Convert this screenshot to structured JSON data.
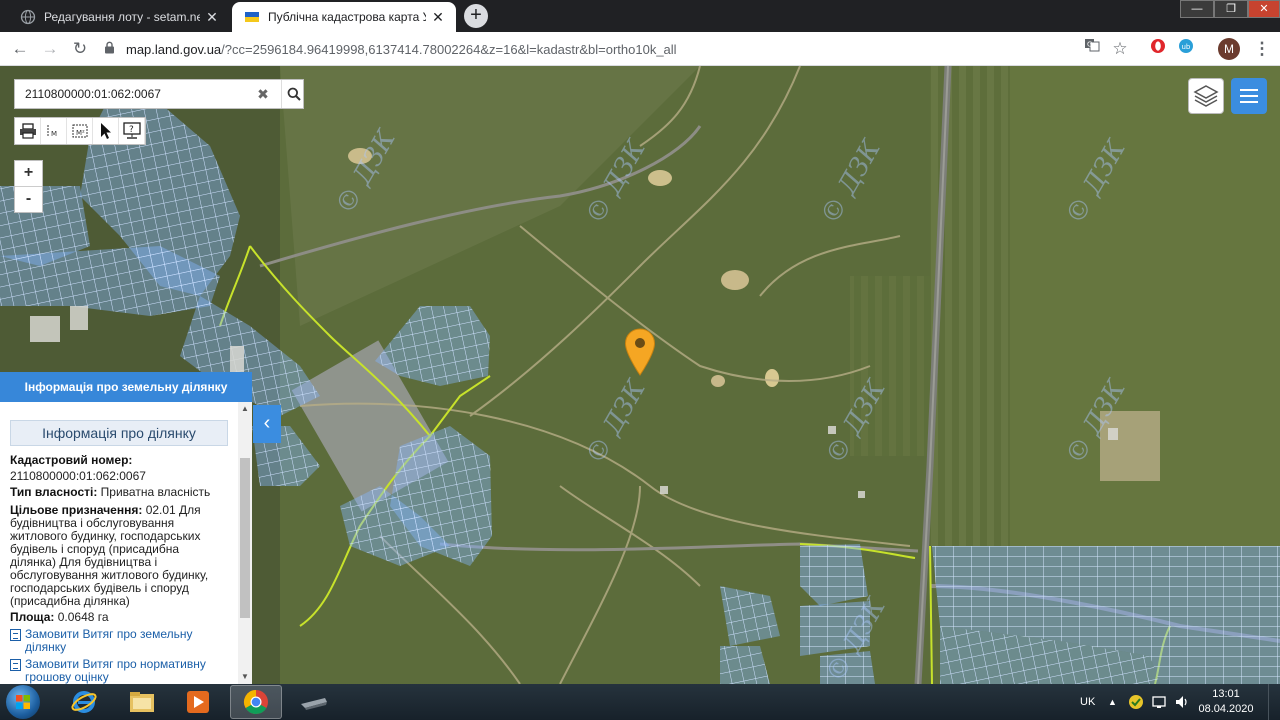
{
  "browser": {
    "tabs": [
      {
        "title": "Редагування лоту - setam.net.ua",
        "favicon": "globe-icon",
        "active": false
      },
      {
        "title": "Публічна кадастрова карта Укр",
        "favicon": "ukraine-flag-icon",
        "active": true
      }
    ],
    "new_tab_label": "+",
    "url_host": "map.land.gov.ua",
    "url_path": "/?cc=2596184.96419998,6137414.78002264&z=16&l=kadastr&bl=ortho10k_all",
    "profile_initial": "M",
    "window_controls": {
      "minimize": "—",
      "maximize": "❐",
      "close": "✕"
    }
  },
  "map": {
    "search": {
      "value": "2110800000:01:062:0067",
      "clear_label": "✖",
      "search_icon": "search-icon"
    },
    "toolbar": [
      "printer-icon",
      "measure-length-icon",
      "measure-area-icon",
      "pointer-icon",
      "identify-icon"
    ],
    "zoom": {
      "in": "+",
      "out": "-"
    },
    "watermark": "© ДЗК",
    "accent_color": "#3787d9",
    "pin_color": "#f5a623"
  },
  "panel": {
    "header": "Інформація про земельну ділянку",
    "subheader": "Інформація про ділянку",
    "cadastral_label": "Кадастровий номер:",
    "cadastral_value": "2110800000:01:062:0067",
    "ownership_label": "Тип власності:",
    "ownership_value": "Приватна власність",
    "purpose_label": "Цільове призначення:",
    "purpose_value": "02.01 Для будівництва і обслуговування житлового будинку, господарських будівель і споруд (присадибна ділянка) Для будівництва і обслуговування житлового будинку, господарських будівель і споруд (присадибна ділянка)",
    "area_label": "Площа:",
    "area_value": "0.0648 га",
    "links": [
      "Замовити Витяг про земельну ділянку",
      "Замовити Витяг про нормативну грошову оцінку"
    ],
    "collapse_label": "‹"
  },
  "taskbar": {
    "apps": [
      "windows-explorer-icon",
      "internet-explorer-icon",
      "file-explorer-icon",
      "media-player-icon",
      "chrome-icon",
      "generic-app-icon"
    ],
    "language": "UK",
    "time": "13:01",
    "date": "08.04.2020"
  }
}
